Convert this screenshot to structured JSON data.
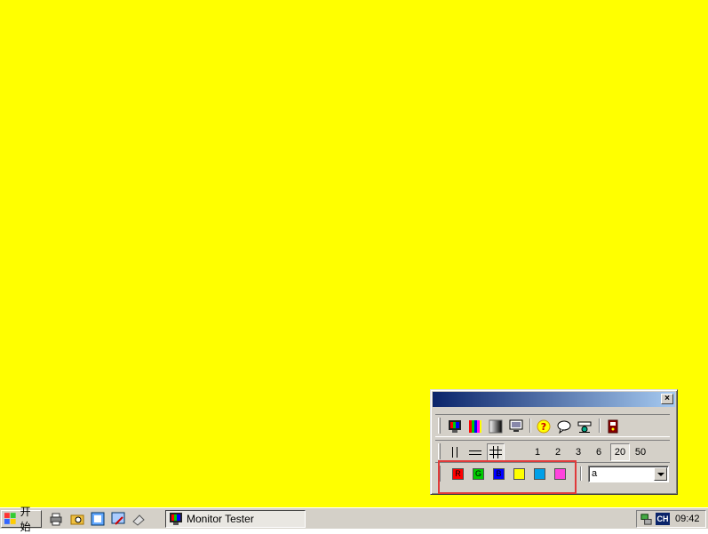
{
  "desktop": {
    "background_color": "#ffff00"
  },
  "tool_window": {
    "close_glyph": "×",
    "row1_icons": [
      "monitor-color-icon",
      "color-bars-icon",
      "gradient-icon",
      "monitor-icon",
      "help-icon",
      "speech-bubble-icon",
      "settings-icon",
      "exit-icon"
    ],
    "row2": {
      "pattern_icons": [
        "vertical-lines-icon",
        "horizontal-lines-icon",
        "grid-icon"
      ],
      "numbers": [
        "1",
        "2",
        "3",
        "6",
        "20",
        "50"
      ],
      "selected_number": "20"
    },
    "row3": {
      "colors": [
        {
          "label": "R",
          "hex": "#ff0000"
        },
        {
          "label": "G",
          "hex": "#00cc00"
        },
        {
          "label": "B",
          "hex": "#0000ff"
        },
        {
          "label": "",
          "hex": "#ffff00"
        },
        {
          "label": "",
          "hex": "#00a0e8"
        },
        {
          "label": "",
          "hex": "#ff44dd"
        }
      ],
      "combo_value": "a"
    }
  },
  "taskbar": {
    "start_label": "开始",
    "quicklaunch": [
      "printer-icon",
      "folder-search-icon",
      "network-icon",
      "tools-icon",
      "eraser-icon"
    ],
    "task_button_label": "Monitor Tester",
    "ime_label": "CH",
    "clock": "09:42"
  },
  "highlight_color": "#e03a3a"
}
